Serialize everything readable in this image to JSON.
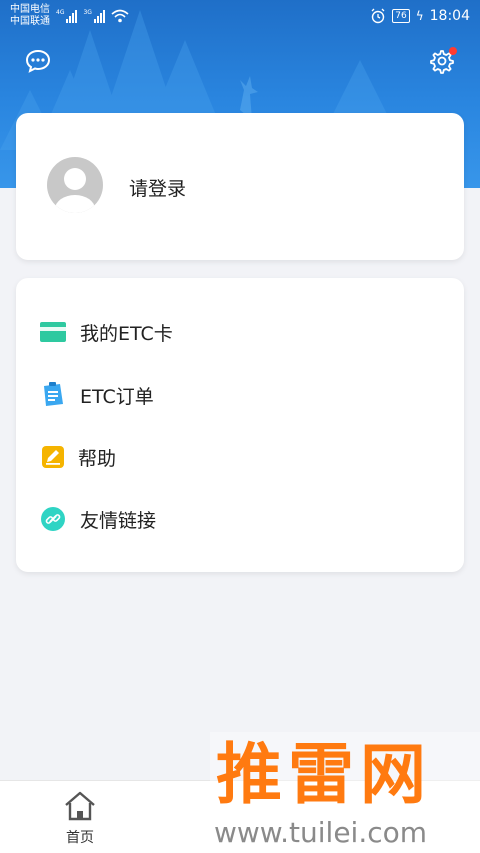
{
  "status_bar": {
    "carrier_1": "中国电信",
    "carrier_2": "中国联通",
    "net_1": "4G",
    "net_2": "3G",
    "battery": "76",
    "time": "18:04"
  },
  "header": {
    "message_icon": "chat-bubble-icon",
    "settings_icon": "gear-icon",
    "settings_badge": true
  },
  "profile": {
    "login_label": "请登录",
    "avatar_icon": "user-avatar-icon"
  },
  "menu": {
    "items": [
      {
        "label": "我的ETC卡",
        "icon": "card-icon",
        "color": "#2ec9a0"
      },
      {
        "label": "ETC订单",
        "icon": "order-icon",
        "color": "#3aa7f0"
      },
      {
        "label": "帮助",
        "icon": "help-pencil-icon",
        "color": "#f5b400"
      },
      {
        "label": "友情链接",
        "icon": "link-icon",
        "color": "#2fd4c4"
      }
    ]
  },
  "bottom_nav": {
    "home_label": "首页",
    "home_icon": "home-icon"
  },
  "watermark": {
    "main": "推雷网",
    "sub": "www.tuilei.com"
  }
}
